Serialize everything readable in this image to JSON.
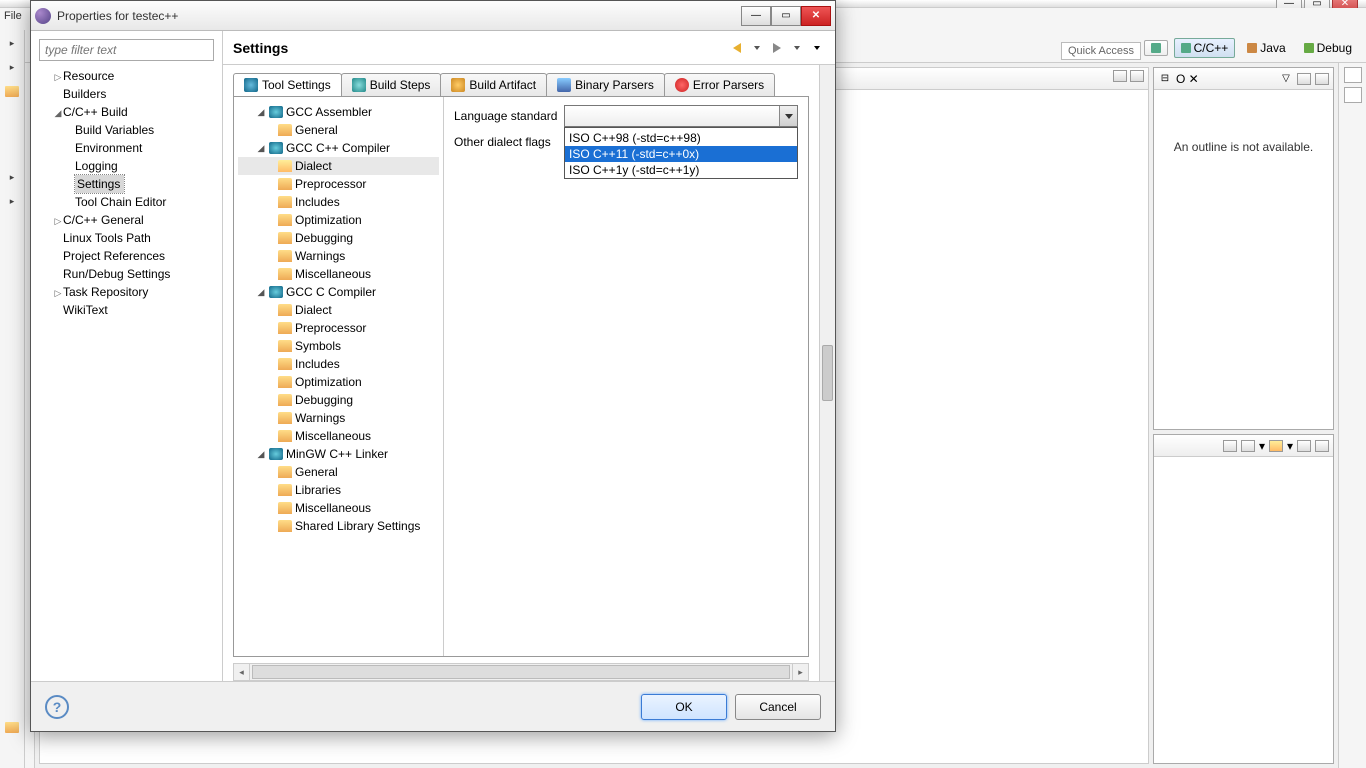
{
  "bg": {
    "quick_access": "Quick Access",
    "persp_ccpp": "C/C++",
    "persp_java": "Java",
    "persp_debug": "Debug",
    "outline_msg": "An outline is not available.",
    "menu_file": "File"
  },
  "dialog": {
    "title": "Properties for testec++",
    "filter_placeholder": "type filter text",
    "header": "Settings",
    "nav": {
      "resource": "Resource",
      "builders": "Builders",
      "ccpp_build": "C/C++ Build",
      "build_vars": "Build Variables",
      "environment": "Environment",
      "logging": "Logging",
      "settings": "Settings",
      "tool_chain": "Tool Chain Editor",
      "ccpp_general": "C/C++ General",
      "linux_tools": "Linux Tools Path",
      "proj_refs": "Project References",
      "run_debug": "Run/Debug Settings",
      "task_repo": "Task Repository",
      "wikitext": "WikiText"
    },
    "tabs": {
      "tool_settings": "Tool Settings",
      "build_steps": "Build Steps",
      "build_artifact": "Build Artifact",
      "binary_parsers": "Binary Parsers",
      "error_parsers": "Error Parsers"
    },
    "tree": {
      "gcc_asm": "GCC Assembler",
      "general": "General",
      "gcc_cpp": "GCC C++ Compiler",
      "dialect": "Dialect",
      "preprocessor": "Preprocessor",
      "includes": "Includes",
      "optimization": "Optimization",
      "debugging": "Debugging",
      "warnings": "Warnings",
      "misc": "Miscellaneous",
      "gcc_c": "GCC C Compiler",
      "symbols": "Symbols",
      "mingw_linker": "MinGW C++ Linker",
      "libraries": "Libraries",
      "shared_lib": "Shared Library Settings"
    },
    "form": {
      "lang_std": "Language standard",
      "other_flags": "Other dialect flags"
    },
    "dropdown": {
      "blank": " ",
      "cpp98": "ISO C++98 (-std=c++98)",
      "cpp11": "ISO C++11 (-std=c++0x)",
      "cpp1y": "ISO C++1y (-std=c++1y)"
    },
    "ok": "OK",
    "cancel": "Cancel"
  }
}
